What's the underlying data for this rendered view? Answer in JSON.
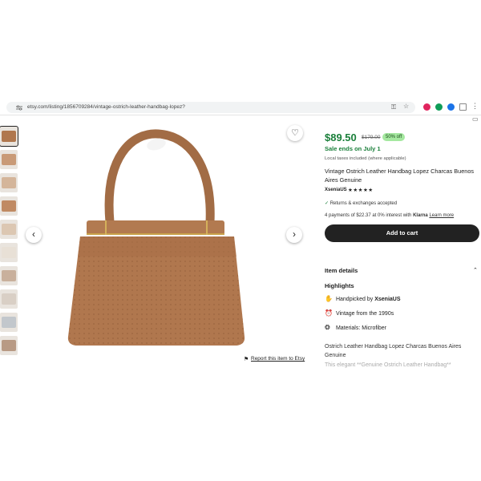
{
  "browser": {
    "url": "etsy.com/listing/1856709284/vintage-ostrich-leather-handbag-lopez?"
  },
  "listing": {
    "price": "$89.50",
    "original_price": "$179.00",
    "discount_badge": "50% off",
    "sale_text": "Sale ends on July 1",
    "tax_note": "Local taxes included (where applicable)",
    "title": "Vintage Ostrich Leather Handbag Lopez Charcas Buenos Aires Genuine",
    "shop_name": "XseniaUS",
    "rating": 5,
    "stars": "★★★★★",
    "returns": "Returns & exchanges accepted",
    "klarna_prefix": "4 payments of $22.37 at 0% interest with",
    "klarna_brand": "Klarna",
    "klarna_link": "Learn more",
    "add_to_cart": "Add to cart",
    "report": "Report this item to Etsy"
  },
  "details": {
    "heading": "Item details",
    "highlights_heading": "Highlights",
    "handpicked_prefix": "Handpicked by",
    "handpicked_by": "XseniaUS",
    "vintage": "Vintage from the 1990s",
    "materials": "Materials: Microfiber",
    "description": "Ostrich Leather Handbag Lopez Charcas Buenos Aires Genuine",
    "description_faded": "This elegant **Genuine Ostrich Leather Handbag**"
  },
  "colors": {
    "price_green": "#1a7f3a",
    "badge_green": "#a5e8a0",
    "bag_brown": "#b0774e",
    "cart_bg": "#222222"
  }
}
